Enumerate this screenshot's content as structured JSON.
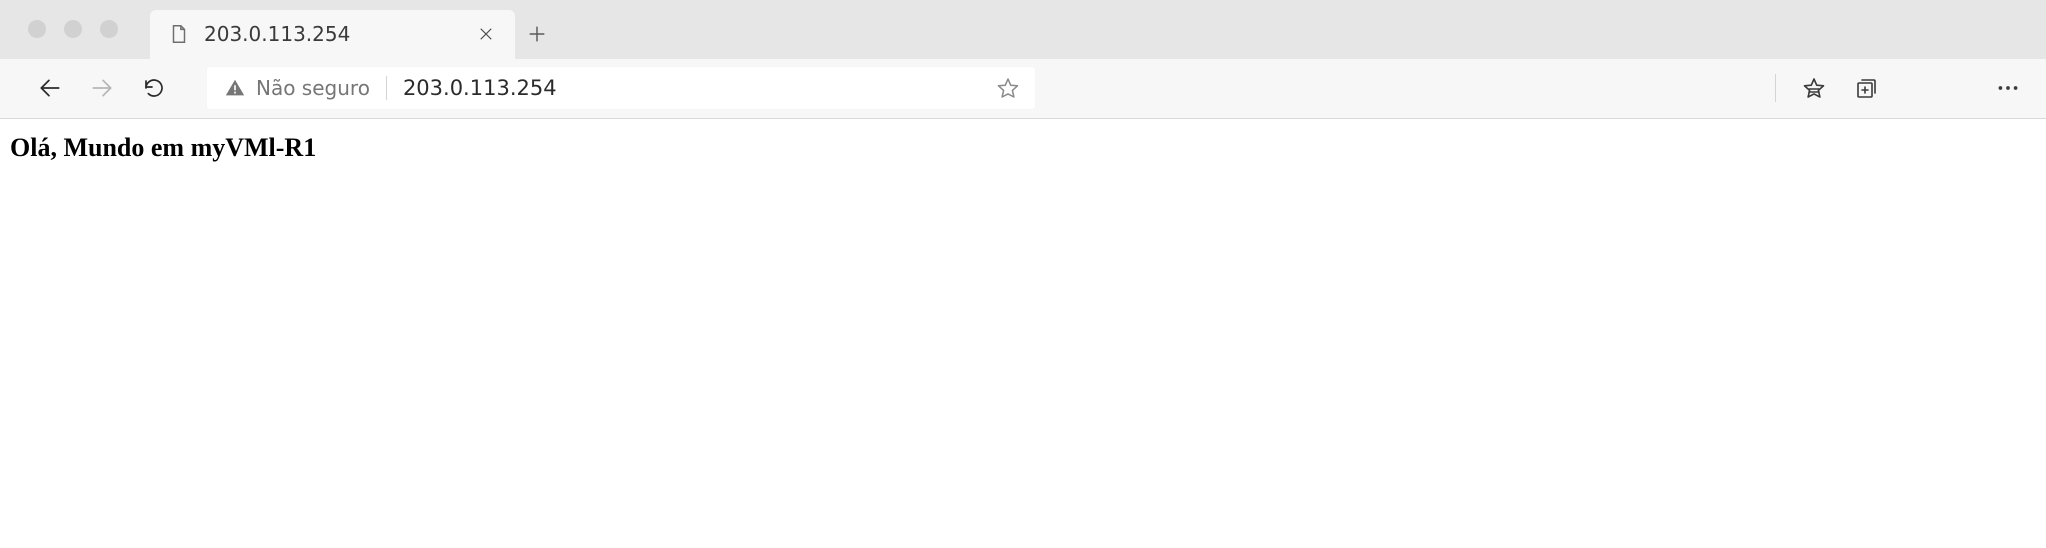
{
  "tab": {
    "title": "203.0.113.254"
  },
  "address_bar": {
    "security_label": "Não seguro",
    "url": "203.0.113.254"
  },
  "page": {
    "body_text": "Olá, Mundo em myVMl-R1"
  }
}
